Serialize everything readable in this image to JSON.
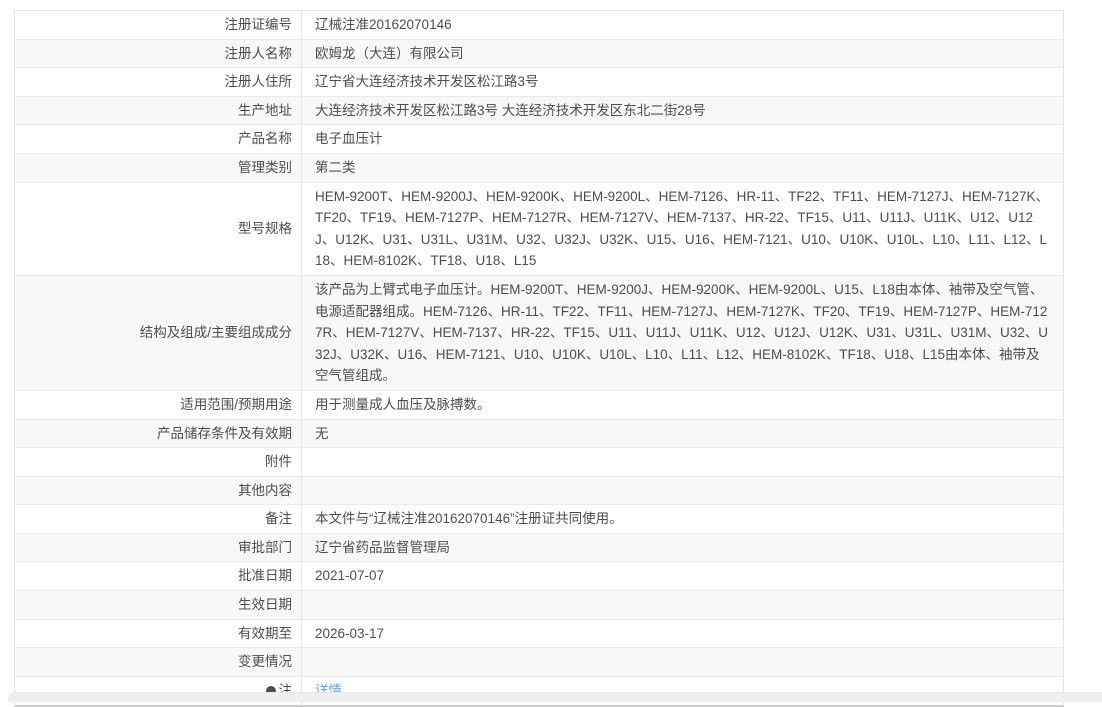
{
  "page": {
    "background_color": "#ffffff",
    "footer_strip_color": "#efefef"
  },
  "table": {
    "border_color": "#e3e3e3",
    "stripe_color": "#f8f8f8",
    "text_color": "#4d4d4d",
    "link_color": "#6b9be0",
    "rows": [
      {
        "label": "注册证编号",
        "value": "辽械注准20162070146"
      },
      {
        "label": "注册人名称",
        "value": "欧姆龙（大连）有限公司"
      },
      {
        "label": "注册人住所",
        "value": "辽宁省大连经济技术开发区松江路3号"
      },
      {
        "label": "生产地址",
        "value": "大连经济技术开发区松江路3号 大连经济技术开发区东北二街28号"
      },
      {
        "label": "产品名称",
        "value": "电子血压计"
      },
      {
        "label": "管理类别",
        "value": "第二类"
      },
      {
        "label": "型号规格",
        "value": "HEM-9200T、HEM-9200J、HEM-9200K、HEM-9200L、HEM-7126、HR-11、TF22、TF11、HEM-7127J、HEM-7127K、TF20、TF19、HEM-7127P、HEM-7127R、HEM-7127V、HEM-7137、HR-22、TF15、U11、U11J、U11K、U12、U12J、U12K、U31、U31L、U31M、U32、U32J、U32K、U15、U16、HEM-7121、U10、U10K、U10L、L10、L11、L12、L18、HEM-8102K、TF18、U18、L15"
      },
      {
        "label": "结构及组成/主要组成成分",
        "value": "该产品为上臂式电子血压计。HEM-9200T、HEM-9200J、HEM-9200K、HEM-9200L、U15、L18由本体、袖带及空气管、电源适配器组成。HEM-7126、HR-11、TF22、TF11、HEM-7127J、HEM-7127K、TF20、TF19、HEM-7127P、HEM-7127R、HEM-7127V、HEM-7137、HR-22、TF15、U11、U11J、U11K、U12、U12J、U12K、U31、U31L、U31M、U32、U32J、U32K、U16、HEM-7121、U10、U10K、U10L、L10、L11、L12、HEM-8102K、TF18、U18、L15由本体、袖带及空气管组成。"
      },
      {
        "label": "适用范围/预期用途",
        "value": "用于测量成人血压及脉搏数。"
      },
      {
        "label": "产品储存条件及有效期",
        "value": "无"
      },
      {
        "label": "附件",
        "value": ""
      },
      {
        "label": "其他内容",
        "value": ""
      },
      {
        "label": "备注",
        "value": "本文件与“辽械注准20162070146”注册证共同使用。"
      },
      {
        "label": "审批部门",
        "value": "辽宁省药品监督管理局"
      },
      {
        "label": "批准日期",
        "value": "2021-07-07"
      },
      {
        "label": "生效日期",
        "value": ""
      },
      {
        "label": "有效期至",
        "value": "2026-03-17"
      },
      {
        "label": "变更情况",
        "value": ""
      },
      {
        "label": "注",
        "value": "详情",
        "icon": "bulb",
        "link": true
      }
    ]
  }
}
